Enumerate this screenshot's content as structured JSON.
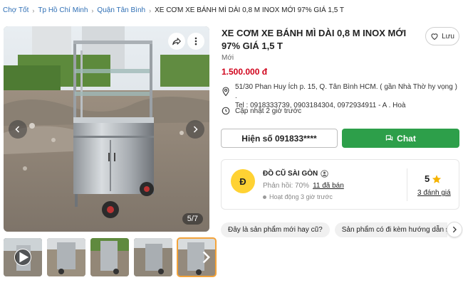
{
  "breadcrumb": [
    "Chợ Tốt",
    "Tp Hồ Chí Minh",
    "Quận Tân Bình",
    "XE CƠM XE BÁNH MÌ DÀI 0,8 M INOX MỚI 97% GIÁ 1,5 T"
  ],
  "gallery": {
    "counter": "5/7",
    "thumbnails": 5,
    "active_thumb_index": 4
  },
  "listing": {
    "title": "XE CƠM XE BÁNH MÌ DÀI 0,8 M INOX MỚI 97% GIÁ 1,5 T",
    "save_label": "Lưu",
    "condition": "Mới",
    "price": "1.500.000 đ",
    "address_line1": "51/30 Phan Huy Ích p. 15, Q. Tân Bình HCM. ( gần Nhà Thờ hy vọng ) .",
    "address_line2": "Tel : 0918333739, 0903184304, 0972934911 - A . Hoà",
    "updated": "Cập nhật 2 giờ trước"
  },
  "actions": {
    "call_label": "Hiện số 091833****",
    "chat_label": "Chat"
  },
  "seller": {
    "avatar_letter": "Đ",
    "name": "ĐỒ CŨ SÀI GÒN",
    "response_rate": "Phản hồi: 70%",
    "sold": "11 đã bán",
    "active": "Hoạt động 3 giờ trước",
    "rating": "5",
    "reviews": "3 đánh giá"
  },
  "questions": [
    "Đây là sản phẩm mới hay cũ?",
    "Sản phẩm có đi kèm hướng dẫn sử dụng không?"
  ],
  "colors": {
    "price": "#d0021b",
    "chat": "#2d9f4a",
    "avatar": "#ffd233",
    "link": "#2f6fb5",
    "star": "#f5b301",
    "active_thumb": "#f3a33a"
  },
  "icons": [
    "share-icon",
    "more-icon",
    "heart-icon",
    "location-icon",
    "clock-icon",
    "chat-icon",
    "user-icon",
    "star-icon",
    "play-icon",
    "chevron-left-icon",
    "chevron-right-icon"
  ]
}
